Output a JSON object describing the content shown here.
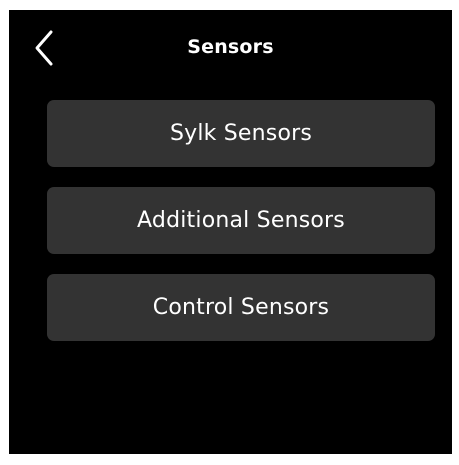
{
  "header": {
    "title": "Sensors",
    "back_icon": "chevron-left-icon"
  },
  "menu": {
    "items": [
      {
        "label": "Sylk Sensors"
      },
      {
        "label": "Additional Sensors"
      },
      {
        "label": "Control Sensors"
      }
    ]
  },
  "colors": {
    "background": "#000000",
    "button": "#333333",
    "text": "#ffffff"
  }
}
